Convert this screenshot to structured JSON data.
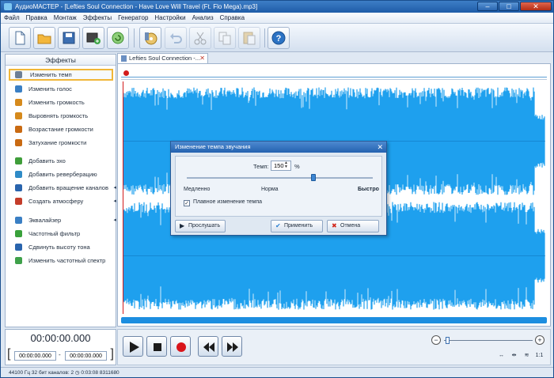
{
  "window": {
    "title": "АудиоМАСТЕР - [Lefties Soul Connection - Have Love Will Travel (Ft. Flo Mega).mp3]"
  },
  "menu": [
    "Файл",
    "Правка",
    "Монтаж",
    "Эффекты",
    "Генератор",
    "Настройки",
    "Анализ",
    "Справка"
  ],
  "toolbar": {
    "icons": [
      "new-file-icon",
      "open-folder-icon",
      "save-icon",
      "add-video-icon",
      "record-icon",
      "cd-icon",
      "undo-icon",
      "cut-icon",
      "copy-icon",
      "paste-icon",
      "help-icon"
    ]
  },
  "effects_panel": {
    "header": "Эффекты",
    "items": [
      {
        "label": "Изменить темп",
        "icon": "tempo-icon",
        "color": "#6d7f95"
      },
      {
        "label": "Изменить голос",
        "icon": "voice-icon",
        "color": "#3a7fc4"
      },
      {
        "label": "Изменить громкость",
        "icon": "volume-icon",
        "color": "#d68a1c"
      },
      {
        "label": "Выровнять громкость",
        "icon": "level-icon",
        "color": "#d68a1c"
      },
      {
        "label": "Возрастание громкости",
        "icon": "fade-in-icon",
        "color": "#c96a12"
      },
      {
        "label": "Затухание громкости",
        "icon": "fade-out-icon",
        "color": "#c96a12"
      },
      {
        "label": "Добавить эхо",
        "icon": "echo-icon",
        "color": "#3f9e3a"
      },
      {
        "label": "Добавить реверберацию",
        "icon": "reverb-icon",
        "color": "#2f8bc7"
      },
      {
        "label": "Добавить вращение каналов",
        "icon": "rotate-icon",
        "color": "#2a64ad"
      },
      {
        "label": "Создать атмосферу",
        "icon": "atmosphere-icon",
        "color": "#c43d2a"
      },
      {
        "label": "Эквалайзер",
        "icon": "equalizer-icon",
        "color": "#3a7fc4"
      },
      {
        "label": "Частотный фильтр",
        "icon": "filter-icon",
        "color": "#39a13b"
      },
      {
        "label": "Сдвинуть высоту тона",
        "icon": "pitch-icon",
        "color": "#2a64ad"
      },
      {
        "label": "Изменить частотный спектр",
        "icon": "spectrum-icon",
        "color": "#3fa14a"
      }
    ]
  },
  "tab": {
    "label": "Lefties Soul Connection -..."
  },
  "dialog": {
    "title": "Изменение темпа звучания",
    "tempo_label": "Темп:",
    "tempo_value": "150",
    "tempo_unit": "%",
    "tempo_fraction": 0.68,
    "label_slow": "Медленно",
    "label_normal": "Норма",
    "label_fast": "Быстро",
    "smooth_label": "Плавное изменение темпа",
    "smooth_checked": true,
    "listen_button": "Прослушать",
    "apply_button": "Применить",
    "cancel_button": "Отмена"
  },
  "timecode": {
    "current": "00:00:00.000",
    "start": "00:00:00.000",
    "end": "00:00:00.000"
  },
  "status": {
    "text": "44100 Гц  32 бит  каналов: 2  ◷ 0:03:08 8311680"
  },
  "colors": {
    "waveform": "#1ea0ee",
    "accent": "#1f5ca8",
    "selection": "#f0b638",
    "playhead": "#d21b1b"
  }
}
